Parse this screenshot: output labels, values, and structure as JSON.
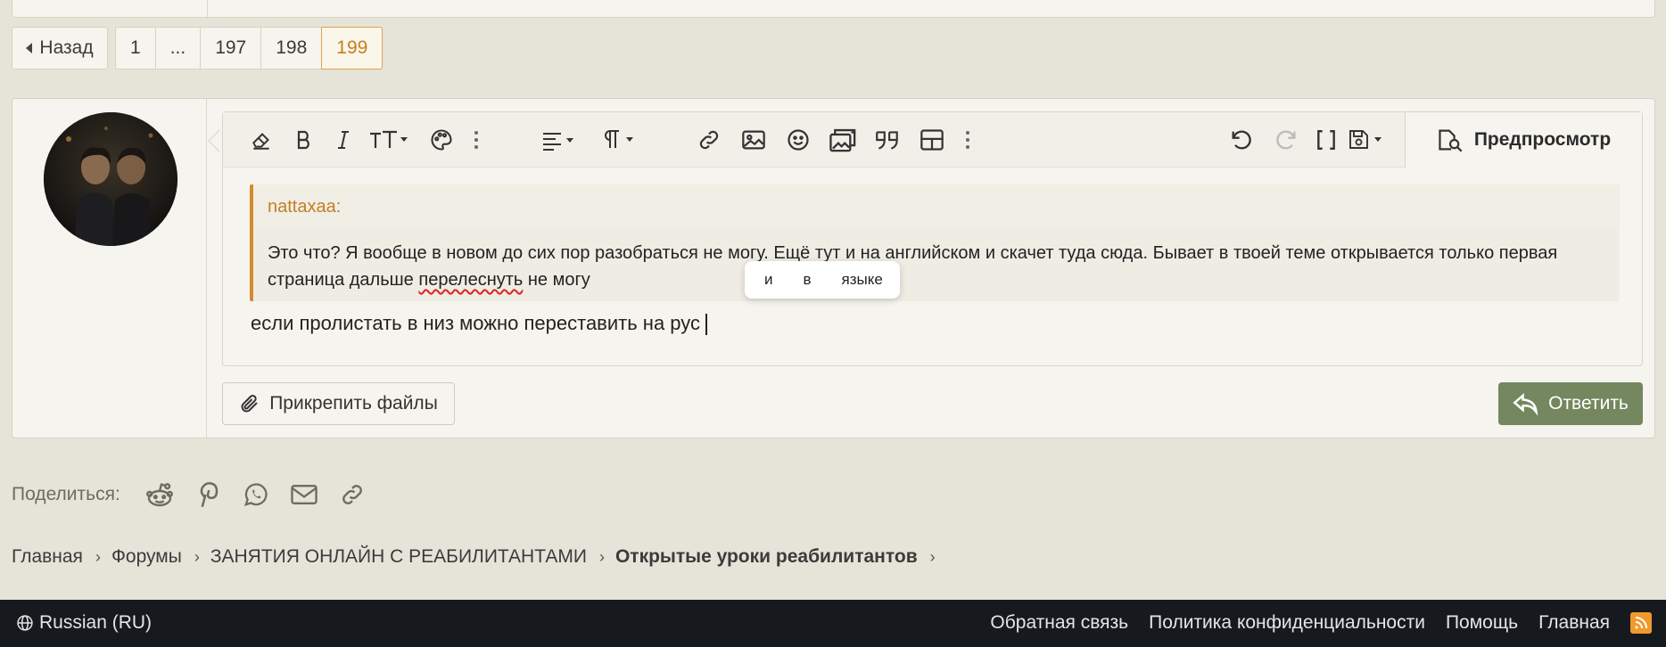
{
  "pagination": {
    "back_label": "Назад",
    "pages": [
      "1",
      "...",
      "197",
      "198",
      "199"
    ],
    "current": "199"
  },
  "editor": {
    "toolbar": [
      {
        "name": "eraser-icon"
      },
      {
        "name": "bold-icon"
      },
      {
        "name": "italic-icon"
      },
      {
        "name": "text-size-icon"
      },
      {
        "name": "palette-icon"
      },
      {
        "name": "more-vertical-icon"
      },
      {
        "name": "align-icon"
      },
      {
        "name": "paragraph-icon"
      },
      {
        "name": "link-icon"
      },
      {
        "name": "image-icon"
      },
      {
        "name": "smiley-icon"
      },
      {
        "name": "media-icon"
      },
      {
        "name": "quote-icon"
      },
      {
        "name": "table-icon"
      },
      {
        "name": "more-vertical-icon"
      },
      {
        "name": "undo-icon"
      },
      {
        "name": "redo-icon"
      },
      {
        "name": "bbcode-icon"
      },
      {
        "name": "save-draft-icon"
      }
    ],
    "preview_label": "Предпросмотр",
    "quote": {
      "author": "nattaxaa:",
      "text_before": "Это что? Я вообще в новом до сих пор разобраться не могу. Ещё тут и на английском и скачет туда сюда. Бывает в твоей теме открывается только первая страница дальше ",
      "misspelled": "перелеснуть",
      "text_after": " не могу"
    },
    "suggestions": [
      "и",
      "в",
      "языке"
    ],
    "input_text": "если пролистать в низ можно переставить на рус"
  },
  "actions": {
    "attach_label": "Прикрепить файлы",
    "reply_label": "Ответить"
  },
  "share": {
    "label": "Поделиться:",
    "icons": [
      "reddit-icon",
      "pinterest-icon",
      "whatsapp-icon",
      "email-icon",
      "link-icon"
    ]
  },
  "breadcrumbs": [
    "Главная",
    "Форумы",
    "ЗАНЯТИЯ ОНЛАЙН С РЕАБИЛИТАНТАМИ",
    "Открытые уроки реабилитантов"
  ],
  "footer": {
    "language": "Russian (RU)",
    "links": [
      "Обратная связь",
      "Политика конфиденциальности",
      "Помощь",
      "Главная"
    ]
  },
  "colors": {
    "accent": "#c47e24",
    "reply_button": "#74875e",
    "footer_bg": "#161a1e",
    "page_bg": "#e6e3d8"
  }
}
